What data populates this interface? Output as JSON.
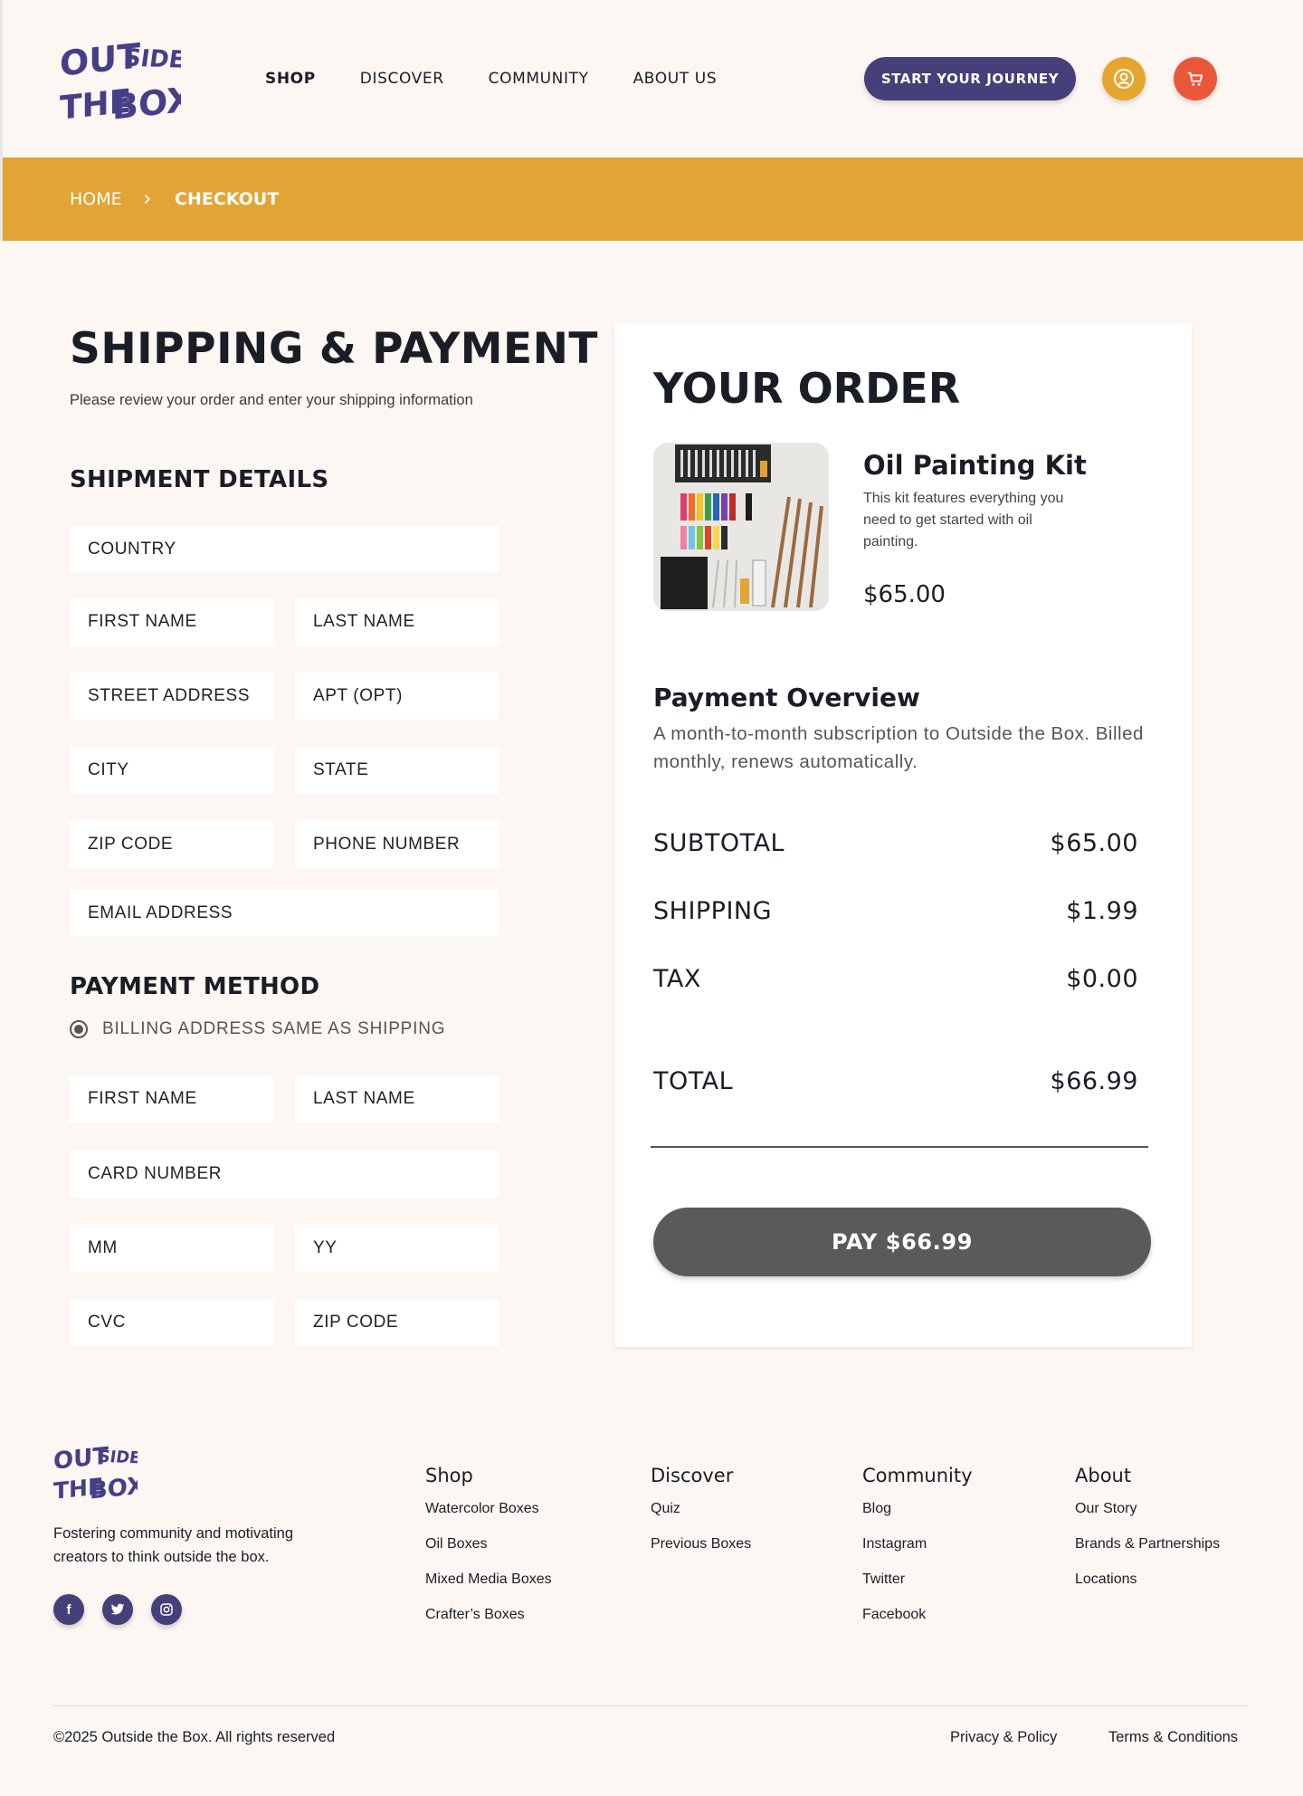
{
  "brand": {
    "logo_lines": [
      "OUT",
      "SIDE",
      "THE",
      "BOX"
    ],
    "color": "#453f88"
  },
  "nav": {
    "items": [
      "SHOP",
      "DISCOVER",
      "COMMUNITY",
      "ABOUT US"
    ],
    "active": "SHOP",
    "cta_label": "START YOUR JOURNEY"
  },
  "header_icons": {
    "user_icon": "user-circle-icon",
    "cart_icon": "cart-icon",
    "user_color": "#e5a630",
    "cart_color": "#e9573a"
  },
  "breadcrumb": {
    "home": "HOME",
    "separator": "›",
    "current": "CHECKOUT",
    "bar_color": "#e2a435"
  },
  "checkout": {
    "title": "SHIPPING & PAYMENT",
    "subtitle": "Please review your order and enter your shipping information",
    "shipment_title": "SHIPMENT DETAILS",
    "shipment_fields": {
      "country": "COUNTRY",
      "first_name": "FIRST NAME",
      "last_name": "LAST NAME",
      "street": "STREET ADDRESS",
      "apt": "APT (OPT)",
      "city": "CITY",
      "state": "STATE",
      "zip": "ZIP CODE",
      "phone": "PHONE NUMBER",
      "email": "EMAIL ADDRESS"
    },
    "payment_title": "PAYMENT METHOD",
    "billing_same_label": "BILLING ADDRESS SAME AS SHIPPING",
    "billing_same_checked": true,
    "payment_fields": {
      "first_name": "FIRST NAME",
      "last_name": "LAST NAME",
      "card_number": "CARD NUMBER",
      "mm": "MM",
      "yy": "YY",
      "cvc": "CVC",
      "zip": "ZIP CODE"
    }
  },
  "order": {
    "title": "YOUR ORDER",
    "product": {
      "name": "Oil Painting Kit",
      "description": "This kit features everything you need to get started with oil painting.",
      "price": "$65.00"
    },
    "overview_title": "Payment Overview",
    "overview_text": "A month-to-month subscription to Outside the Box. Billed monthly, renews automatically.",
    "subtotal_label": "SUBTOTAL",
    "subtotal": "$65.00",
    "shipping_label": "SHIPPING",
    "shipping": "$1.99",
    "tax_label": "TAX",
    "tax": "$0.00",
    "total_label": "TOTAL",
    "total": "$66.99",
    "pay_label": "PAY $66.99"
  },
  "footer": {
    "tagline": "Fostering community and motivating creators to think outside the box.",
    "socials": [
      "facebook-icon",
      "twitter-icon",
      "instagram-icon"
    ],
    "columns": [
      {
        "title": "Shop",
        "links": [
          "Watercolor Boxes",
          "Oil Boxes",
          "Mixed Media Boxes",
          "Crafter’s Boxes"
        ]
      },
      {
        "title": "Discover",
        "links": [
          "Quiz",
          "Previous Boxes"
        ]
      },
      {
        "title": "Community",
        "links": [
          "Blog",
          "Instagram",
          "Twitter",
          "Facebook"
        ]
      },
      {
        "title": "About",
        "links": [
          "Our Story",
          "Brands & Partnerships",
          "Locations"
        ]
      }
    ],
    "copyright": "©2025 Outside the Box. All rights reserved",
    "privacy": "Privacy & Policy",
    "terms": "Terms & Conditions"
  }
}
